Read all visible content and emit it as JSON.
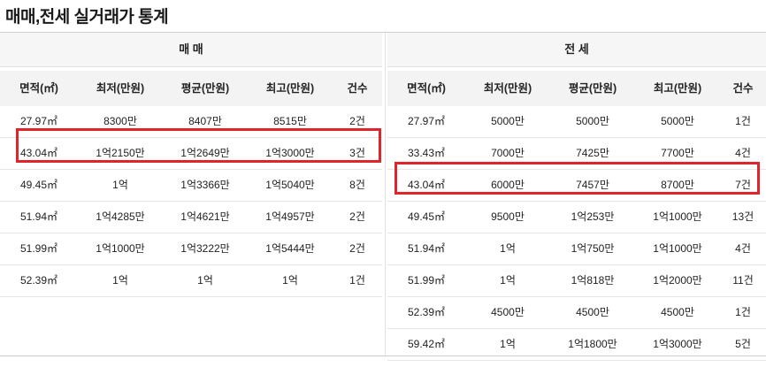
{
  "title": "매매,전세 실거래가 통계",
  "columns": [
    "면적(㎡)",
    "최저(만원)",
    "평균(만원)",
    "최고(만원)",
    "건수"
  ],
  "sale": {
    "heading": "매 매",
    "rows": [
      [
        "27.97㎡",
        "8300만",
        "8407만",
        "8515만",
        "2건"
      ],
      [
        "43.04㎡",
        "1억2150만",
        "1억2649만",
        "1억3000만",
        "3건"
      ],
      [
        "49.45㎡",
        "1억",
        "1억3366만",
        "1억5040만",
        "8건"
      ],
      [
        "51.94㎡",
        "1억4285만",
        "1억4621만",
        "1억4957만",
        "2건"
      ],
      [
        "51.99㎡",
        "1억1000만",
        "1억3222만",
        "1억5444만",
        "2건"
      ],
      [
        "52.39㎡",
        "1억",
        "1억",
        "1억",
        "1건"
      ]
    ]
  },
  "jeonse": {
    "heading": "전 세",
    "rows": [
      [
        "27.97㎡",
        "5000만",
        "5000만",
        "5000만",
        "1건"
      ],
      [
        "33.43㎡",
        "7000만",
        "7425만",
        "7700만",
        "4건"
      ],
      [
        "43.04㎡",
        "6000만",
        "7457만",
        "8700만",
        "7건"
      ],
      [
        "49.45㎡",
        "9500만",
        "1억253만",
        "1억1000만",
        "13건"
      ],
      [
        "51.94㎡",
        "1억",
        "1억750만",
        "1억1000만",
        "4건"
      ],
      [
        "51.99㎡",
        "1억",
        "1억818만",
        "1억2000만",
        "11건"
      ],
      [
        "52.39㎡",
        "4500만",
        "4500만",
        "4500만",
        "1건"
      ],
      [
        "59.42㎡",
        "1억",
        "1억1800만",
        "1억3000만",
        "5건"
      ]
    ]
  },
  "highlight_color": "#e0242b"
}
